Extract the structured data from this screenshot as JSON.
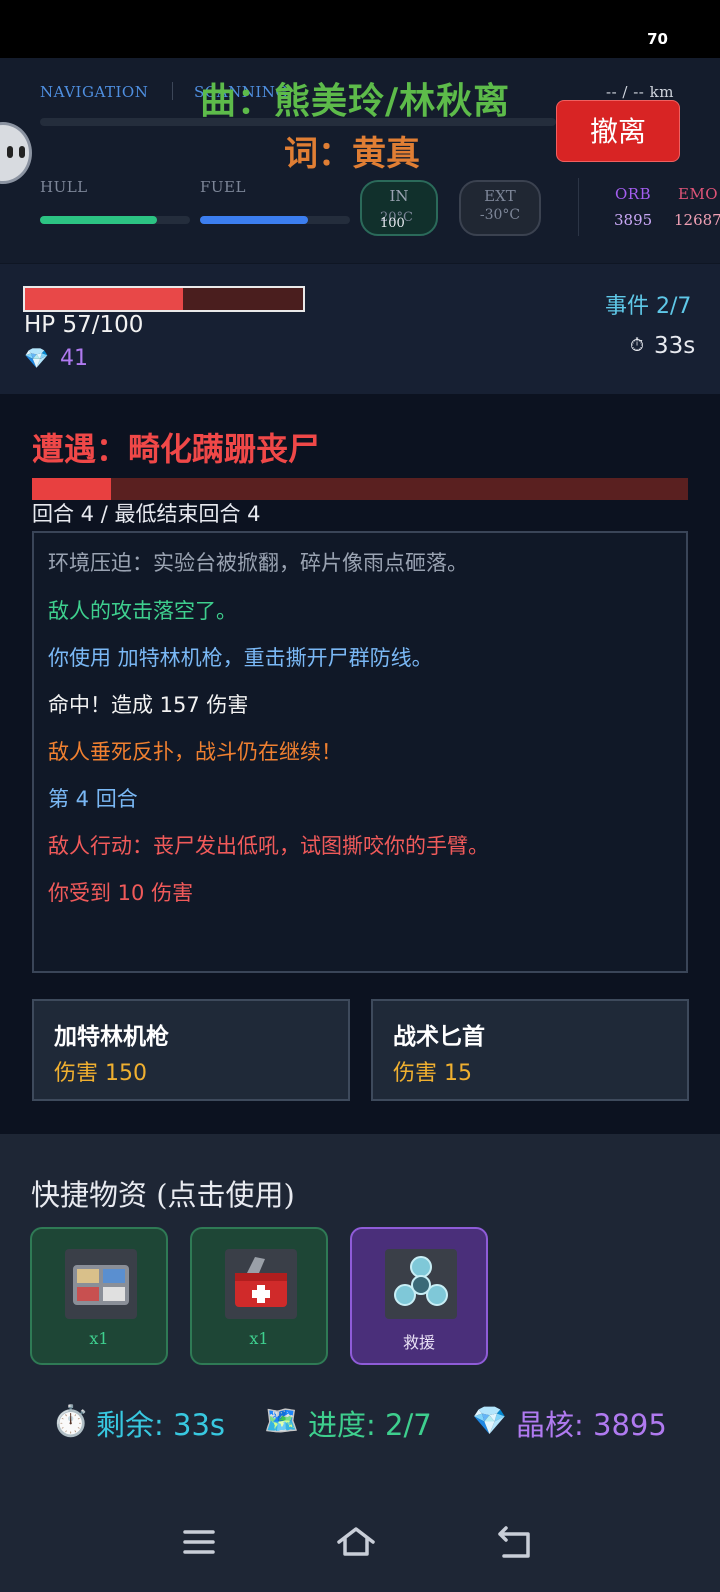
{
  "status_bar": {
    "battery": "70"
  },
  "hud": {
    "navigation_label": "NAVIGATION",
    "scanning_label": "SCANNING",
    "distance": "-- / -- km",
    "hull_label": "HULL",
    "hull_level": 0.78,
    "fuel_label": "FUEL",
    "fuel_level": 0.72,
    "in_label": "IN",
    "in_temp": "20°C",
    "in_value": "100",
    "ext_label": "EXT",
    "ext_temp": "-30°C",
    "orb_label": "ORB",
    "orb_value": "3895",
    "emo_label": "EMO",
    "emo_value": "12687",
    "evacuate_label": "撤离"
  },
  "overlay": {
    "song_line": "曲：熊美玲/林秋离",
    "lyric_line": "词：黄真"
  },
  "player": {
    "hp_text": "HP 57/100",
    "hp_fraction": 0.57,
    "gem_icon": "💎",
    "gems": "41",
    "event_progress": "事件 2/7",
    "timer_icon": "⏱",
    "timer": "33s"
  },
  "encounter": {
    "title": "遭遇：畸化蹒跚丧尸",
    "enemy_health_fraction": 0.12,
    "round_text": "回合 4 / 最低结束回合 4",
    "log": [
      {
        "text": "环境压迫：实验台被掀翻，碎片像雨点砸落。",
        "color": "#9aa3b2"
      },
      {
        "text": "敌人的攻击落空了。",
        "color": "#3ecf8e"
      },
      {
        "text": "你使用 加特林机枪，重击撕开尸群防线。",
        "color": "#7ab8f5"
      },
      {
        "text": "命中！造成 157 伤害",
        "color": "#f2f2f2"
      },
      {
        "text": "敌人垂死反扑，战斗仍在继续！",
        "color": "#f08030"
      },
      {
        "text": "第 4 回合",
        "color": "#7ab8f5"
      },
      {
        "text": "敌人行动：丧尸发出低吼，试图撕咬你的手臂。",
        "color": "#f05a5a"
      },
      {
        "text": "你受到 10 伤害",
        "color": "#f05a5a"
      }
    ],
    "weapons": [
      {
        "name": "加特林机枪",
        "damage": "伤害 150"
      },
      {
        "name": "战术匕首",
        "damage": "伤害 15"
      }
    ]
  },
  "supplies": {
    "title": "快捷物资 (点击使用)",
    "items": [
      {
        "icon": "supply-kit-icon",
        "label": "x1"
      },
      {
        "icon": "toolbox-icon",
        "label": "x1"
      },
      {
        "icon": "spinner-icon",
        "label": "救援"
      }
    ]
  },
  "summary": {
    "remaining_icon": "⏱️",
    "remaining": "剩余: 33s",
    "progress_icon": "🗺️",
    "progress": "进度: 2/7",
    "core_icon": "💎",
    "cores": "晶核: 3895"
  }
}
